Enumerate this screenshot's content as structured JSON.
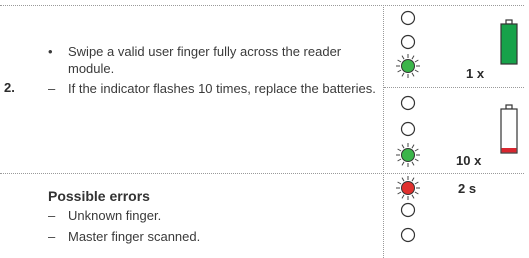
{
  "step": {
    "number": "2.",
    "items": [
      {
        "marker": "•",
        "text": "Swipe a valid user finger fully across the reader module."
      },
      {
        "marker": "–",
        "text": "If the indicator flashes 10 times, replace the batteries."
      }
    ]
  },
  "errors": {
    "heading": "Possible errors",
    "items": [
      {
        "marker": "–",
        "text": "Unknown finger."
      },
      {
        "marker": "–",
        "text": "Master finger scanned."
      }
    ]
  },
  "indicators": [
    {
      "leds": [
        "off",
        "off",
        "green"
      ],
      "count": "1 x",
      "battery": "full"
    },
    {
      "leds": [
        "off",
        "off",
        "green"
      ],
      "count": "10 x",
      "battery": "low"
    },
    {
      "leds": [
        "red",
        "off",
        "off"
      ],
      "count": "2 s",
      "battery": "none"
    }
  ],
  "colors": {
    "green": "#3bb54a",
    "red": "#e0302e",
    "battery_full": "#17a24a",
    "battery_low": "#d9262f",
    "outline": "#333333",
    "dotted": "#9a9a9a"
  }
}
